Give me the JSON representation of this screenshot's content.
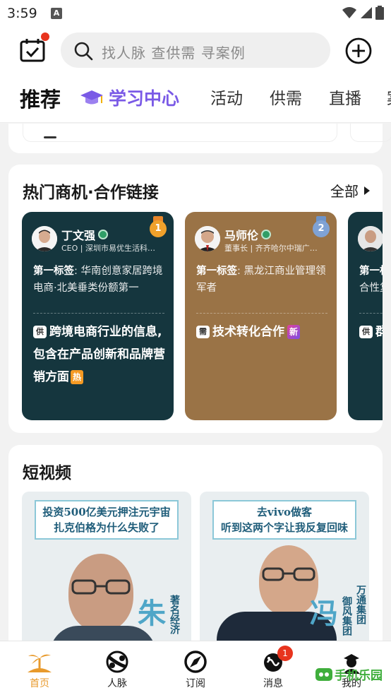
{
  "status_bar": {
    "time": "3:59",
    "notif_letter": "A"
  },
  "top_bar": {
    "search_placeholder": "找人脉 查供需 寻案例"
  },
  "tabs": [
    {
      "label": "推荐",
      "active": true
    },
    {
      "label": "学习中心"
    },
    {
      "label": "活动"
    },
    {
      "label": "供需"
    },
    {
      "label": "直播"
    },
    {
      "label": "案"
    }
  ],
  "hot": {
    "title": "热门商机·合作链接",
    "see_all": "全部",
    "cards": [
      {
        "name": "丁文强",
        "sub": "CEO | 深圳市易优生活科…",
        "rank": "1",
        "tag_label": "第一标签",
        "tag_text": ": 华南创意家居跨境电商·北美垂类份额第一",
        "type_badge": "供",
        "body": "跨境电商行业的信息,包含在产品创新和品牌营销方面",
        "flag": "热",
        "bg": "#15363e"
      },
      {
        "name": "马师伦",
        "sub": "董事长 | 齐齐哈尔中瑞广…",
        "rank": "2",
        "tag_label": "第一标签",
        "tag_text": ": 黑龙江商业管理领军者",
        "type_badge": "需",
        "body": "技术转化合作",
        "flag": "新",
        "bg": "#9a7346"
      },
      {
        "name": "",
        "sub": "",
        "tag_label": "第一标",
        "tag_text": "合性复",
        "type_badge": "供",
        "body": "群提服务",
        "bg": "#15363e"
      }
    ]
  },
  "videos": {
    "title": "短视频",
    "items": [
      {
        "caption_1": "投资500亿美元押注元宇宙",
        "caption_2": "扎克伯格为什么失败了",
        "side_name": "朱",
        "side_small": "著名经济"
      },
      {
        "caption_1": "去vivo做客",
        "caption_2": "听到这两个字让我反复回味",
        "side_name": "冯",
        "side_small_1": "御风集团",
        "side_small_2": "万通集团"
      }
    ]
  },
  "bottom_nav": [
    {
      "label": "首页",
      "active": true
    },
    {
      "label": "人脉"
    },
    {
      "label": "订阅"
    },
    {
      "label": "消息",
      "badge": "1"
    },
    {
      "label": "我的"
    }
  ],
  "watermark": "手机乐园"
}
